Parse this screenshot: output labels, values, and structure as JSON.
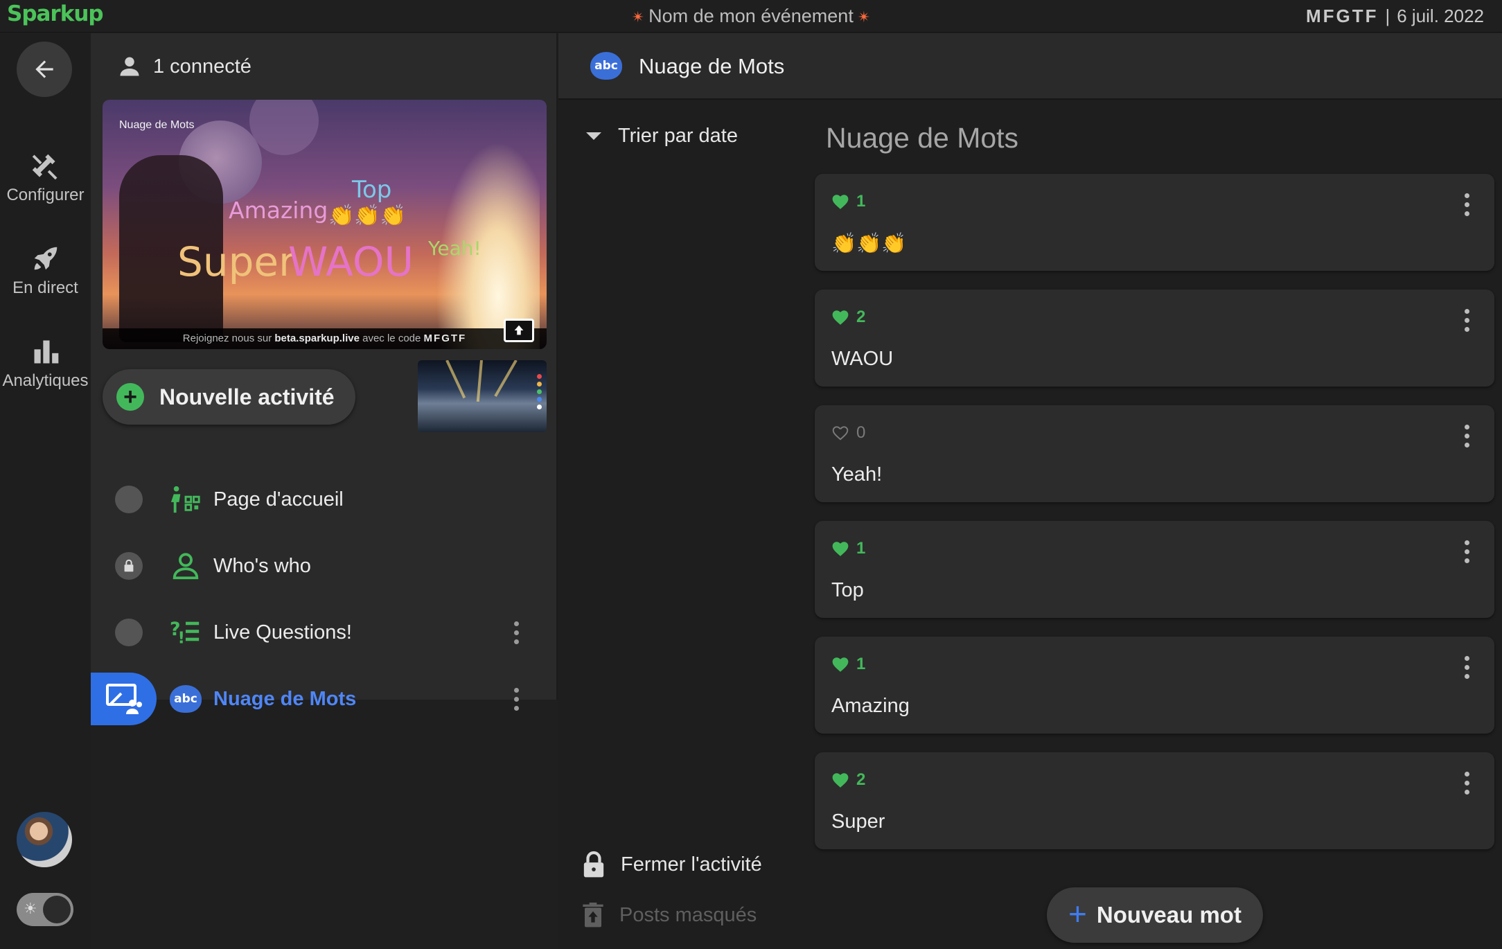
{
  "topbar": {
    "logo": "Sparkup",
    "event_title": "Nom de mon événement",
    "event_code": "MFGTF",
    "separator": "|",
    "date": "6 juil. 2022"
  },
  "rail": {
    "items": [
      {
        "label": "Configurer",
        "icon": "tools-icon"
      },
      {
        "label": "En direct",
        "icon": "rocket-icon"
      },
      {
        "label": "Analytiques",
        "icon": "bar-chart-icon"
      }
    ]
  },
  "panel": {
    "connected": "1 connecté",
    "preview": {
      "small_title": "Nuage de Mots",
      "words": {
        "top": "Top",
        "amazing": "Amazing",
        "emoji": "👏👏👏",
        "yeah": "Yeah!",
        "super": "Super",
        "waou": "WAOU"
      },
      "caption_prefix": "Rejoignez nous sur",
      "caption_url": "beta.sparkup.live",
      "caption_mid": "avec le code",
      "caption_code": "MFGTF"
    },
    "new_activity": "Nouvelle activité",
    "activities": [
      {
        "label": "Page d'accueil",
        "icon": "qr-person-icon",
        "state": "off"
      },
      {
        "label": "Who's who",
        "icon": "person-outline-icon",
        "state": "locked"
      },
      {
        "label": "Live Questions!",
        "icon": "question-list-icon",
        "state": "off"
      },
      {
        "label": "Nuage de Mots",
        "icon": "word-cloud-icon",
        "state": "live"
      }
    ]
  },
  "main": {
    "header_title": "Nuage de Mots",
    "header_badge": "abc",
    "sort_label": "Trier par date",
    "list_title": "Nuage de Mots",
    "cards": [
      {
        "likes": "1",
        "word": "👏👏👏",
        "liked": true
      },
      {
        "likes": "2",
        "word": "WAOU",
        "liked": true
      },
      {
        "likes": "0",
        "word": "Yeah!",
        "liked": false
      },
      {
        "likes": "1",
        "word": "Top",
        "liked": true
      },
      {
        "likes": "1",
        "word": "Amazing",
        "liked": true
      },
      {
        "likes": "2",
        "word": "Super",
        "liked": true
      }
    ],
    "close_activity": "Fermer l'activité",
    "hidden_posts": "Posts masqués",
    "new_word": "Nouveau mot"
  },
  "colors": {
    "accent_green": "#43b85b",
    "accent_blue": "#3f7cf0",
    "background": "#1e1e1e",
    "panel": "#2a2a2a"
  }
}
